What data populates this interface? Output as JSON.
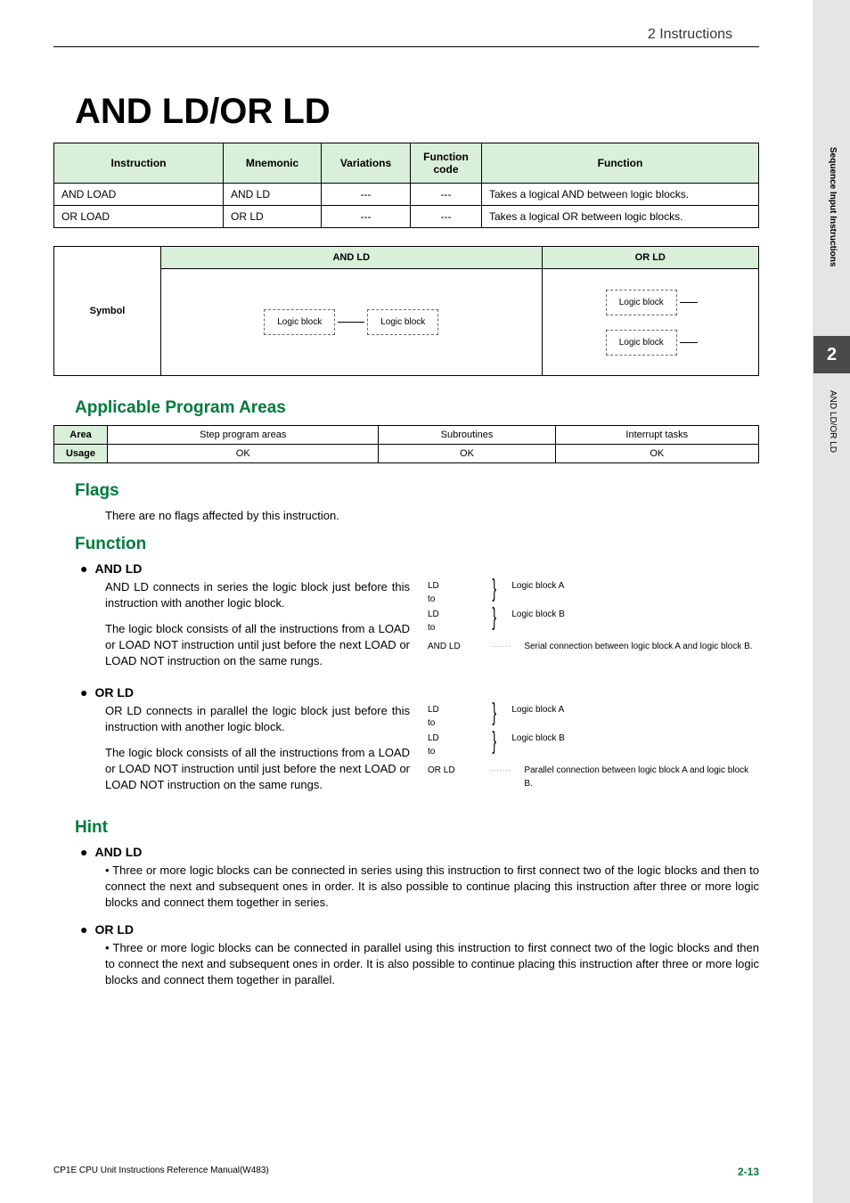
{
  "header": {
    "section": "2  Instructions"
  },
  "title": "AND LD/OR LD",
  "inst_table": {
    "headers": [
      "Instruction",
      "Mnemonic",
      "Variations",
      "Function code",
      "Function"
    ],
    "rows": [
      {
        "instruction": "AND LOAD",
        "mnemonic": "AND LD",
        "variations": "---",
        "code": "---",
        "function": "Takes a logical AND between logic blocks."
      },
      {
        "instruction": "OR LOAD",
        "mnemonic": "OR LD",
        "variations": "---",
        "code": "---",
        "function": "Takes a logical OR between logic blocks."
      }
    ]
  },
  "symbol_table": {
    "row_label": "Symbol",
    "headers": [
      "AND LD",
      "OR LD"
    ],
    "logic_block_label": "Logic block"
  },
  "sections": {
    "applicable": {
      "title": "Applicable Program Areas",
      "headers": [
        "Area",
        "Step program areas",
        "Subroutines",
        "Interrupt tasks"
      ],
      "row_label": "Usage",
      "values": [
        "OK",
        "OK",
        "OK"
      ]
    },
    "flags": {
      "title": "Flags",
      "text": "There are no flags affected by this instruction."
    },
    "function": {
      "title": "Function",
      "andld": {
        "label": "AND LD",
        "p1": "AND LD connects in series the logic block just before this instruction with another logic block.",
        "p2": "The logic block consists of all the instructions from a LOAD or LOAD NOT instruction until just before the next LOAD or LOAD NOT instruction on the same rungs."
      },
      "orld": {
        "label": "OR LD",
        "p1": "OR LD connects in parallel the logic block just before this instruction with another logic block.",
        "p2": "The logic block consists of all the instructions from a LOAD or LOAD NOT instruction until just before the next LOAD or LOAD NOT instruction on the same rungs."
      },
      "diagram": {
        "ld": "LD",
        "to": "to",
        "blockA": "Logic block A",
        "blockB": "Logic block B",
        "andld": "AND LD",
        "orld": "OR LD",
        "serial_note": "Serial connection between logic block A and logic block B.",
        "parallel_note": "Parallel connection between logic block A and logic block B."
      }
    },
    "hint": {
      "title": "Hint",
      "andld": {
        "label": "AND LD",
        "text": "Three or more logic blocks can be connected in series using this instruction to first connect two of the logic blocks and then to connect the next and subsequent ones in order. It is also possible to continue placing this instruction after three or more logic blocks and connect them together in series."
      },
      "orld": {
        "label": "OR LD",
        "text": "Three or more logic blocks can be connected in parallel using this instruction to first connect two of the logic blocks and then to connect the next and subsequent ones in order. It is also possible to continue placing this instruction after three or more logic blocks and connect them together in parallel."
      }
    }
  },
  "sidebar": {
    "chapter": "2",
    "vert1": "Sequence Input Instructions",
    "vert2": "AND LD/OR LD"
  },
  "footer": {
    "manual": "CP1E CPU Unit Instructions Reference Manual(W483)",
    "page": "2-13"
  }
}
